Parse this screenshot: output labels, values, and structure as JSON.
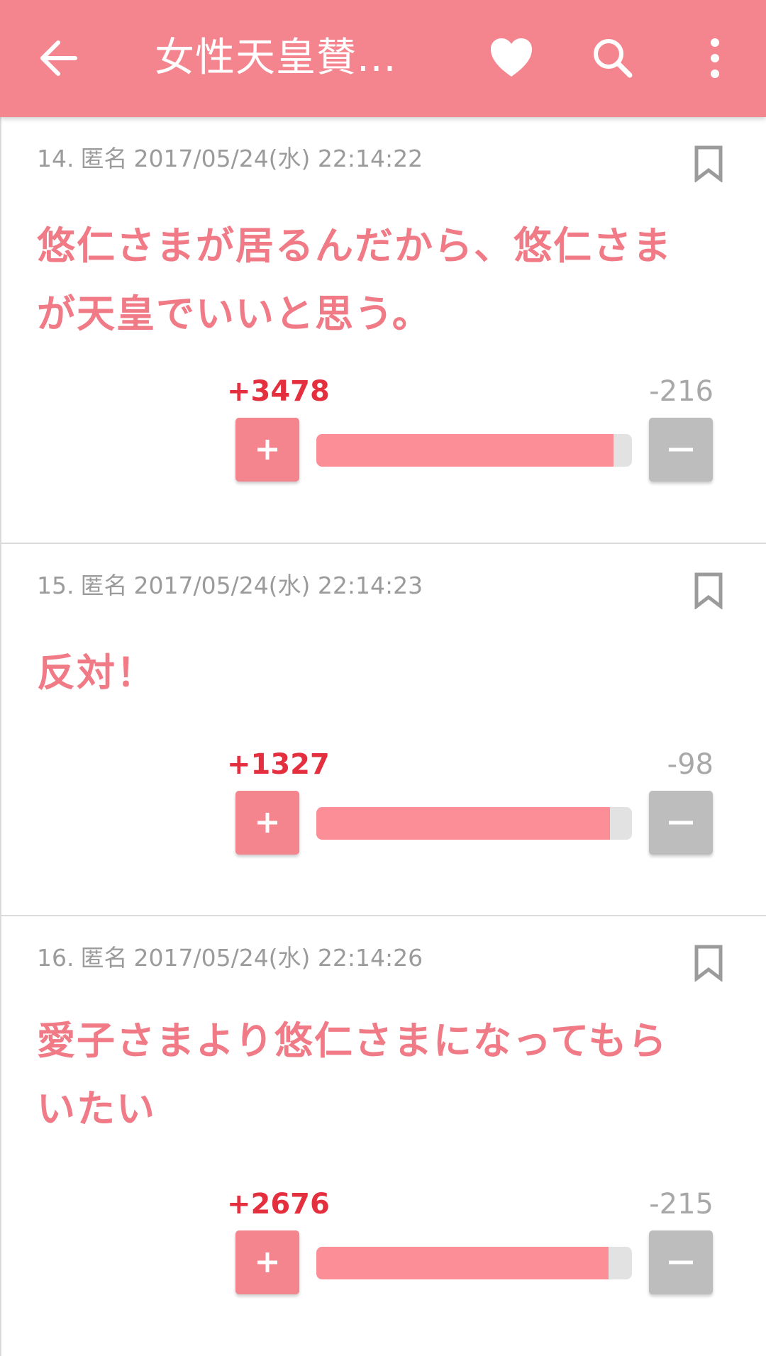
{
  "app_bar": {
    "title": "女性天皇賛...",
    "back_icon": "arrow-left-icon",
    "favorite_icon": "heart-icon",
    "search_icon": "search-icon",
    "menu_icon": "more-vertical-icon",
    "background_color": "#f4848d"
  },
  "colors": {
    "accent": "#f4848d",
    "comment_text": "#f07a86",
    "plus_count": "#e4303e",
    "minus_count": "#a8a8a8",
    "minus_button": "#bdbdbd",
    "bar_fill": "#fb8e97",
    "bar_track": "#e2e2e2"
  },
  "comments": [
    {
      "number": "14.",
      "author": "匿名",
      "timestamp": "2017/05/24(水) 22:14:22",
      "lines": [
        "悠仁さまが居るんだから、悠仁さま",
        "が天皇でいいと思う。"
      ],
      "plus": "+3478",
      "minus": "-216",
      "plus_ratio": 0.9415
    },
    {
      "number": "15.",
      "author": "匿名",
      "timestamp": "2017/05/24(水) 22:14:23",
      "lines": [
        "反対！"
      ],
      "plus": "+1327",
      "minus": "-98",
      "plus_ratio": 0.9312
    },
    {
      "number": "16.",
      "author": "匿名",
      "timestamp": "2017/05/24(水) 22:14:26",
      "lines": [
        "愛子さまより悠仁さまになってもら",
        "いたい"
      ],
      "plus": "+2676",
      "minus": "-215",
      "plus_ratio": 0.9256
    }
  ],
  "icons": {
    "bookmark": "bookmark-icon",
    "plus_button": "plus-icon",
    "minus_button": "minus-icon"
  }
}
